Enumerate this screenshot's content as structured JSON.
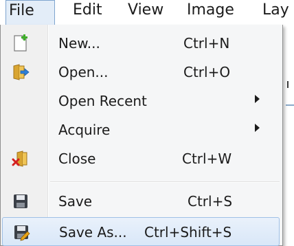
{
  "menubar": {
    "items": [
      "File",
      "Edit",
      "View",
      "Image",
      "Lay"
    ]
  },
  "menu": {
    "items": [
      {
        "label": "New...",
        "shortcut": "Ctrl+N",
        "icon": "new-document-icon"
      },
      {
        "label": "Open...",
        "shortcut": "Ctrl+O",
        "icon": "open-folder-icon"
      },
      {
        "label": "Open Recent",
        "shortcut": "",
        "submenu": true
      },
      {
        "label": "Acquire",
        "shortcut": "",
        "submenu": true
      },
      {
        "label": "Close",
        "shortcut": "Ctrl+W",
        "icon": "close-document-icon"
      },
      {
        "label": "Save",
        "shortcut": "Ctrl+S",
        "icon": "save-icon"
      },
      {
        "label": "Save As...",
        "shortcut": "Ctrl+Shift+S",
        "icon": "save-as-icon",
        "highlighted": true
      }
    ]
  }
}
